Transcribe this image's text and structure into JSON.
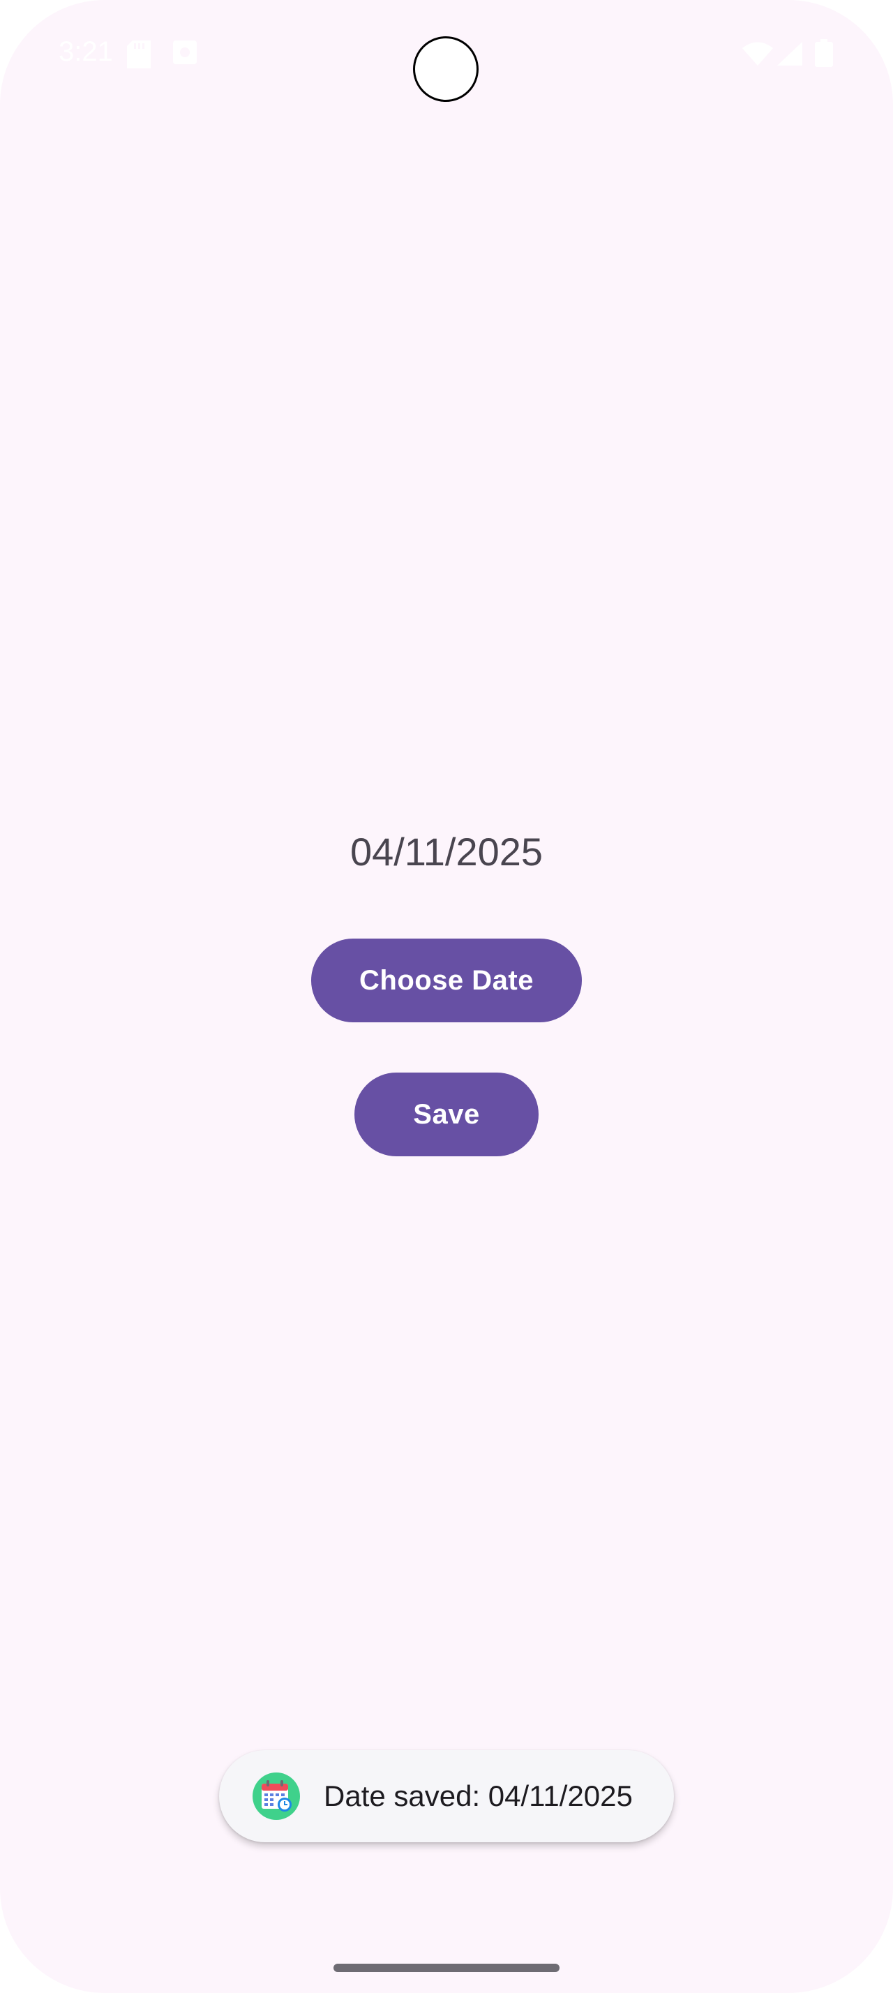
{
  "status_bar": {
    "time": "3:21",
    "left_icons": [
      "sd-card-icon",
      "notification-icon"
    ],
    "right_icons": [
      "wifi-icon",
      "signal-icon",
      "battery-icon"
    ]
  },
  "main": {
    "selected_date": "04/11/2025",
    "choose_date_label": "Choose Date",
    "save_label": "Save"
  },
  "toast": {
    "icon": "calendar-app-icon",
    "message": "Date saved: 04/11/2025"
  },
  "colors": {
    "background": "#fdf5fc",
    "primary": "#6750a4",
    "on_primary": "#ffffff",
    "date_text": "#49454f"
  }
}
